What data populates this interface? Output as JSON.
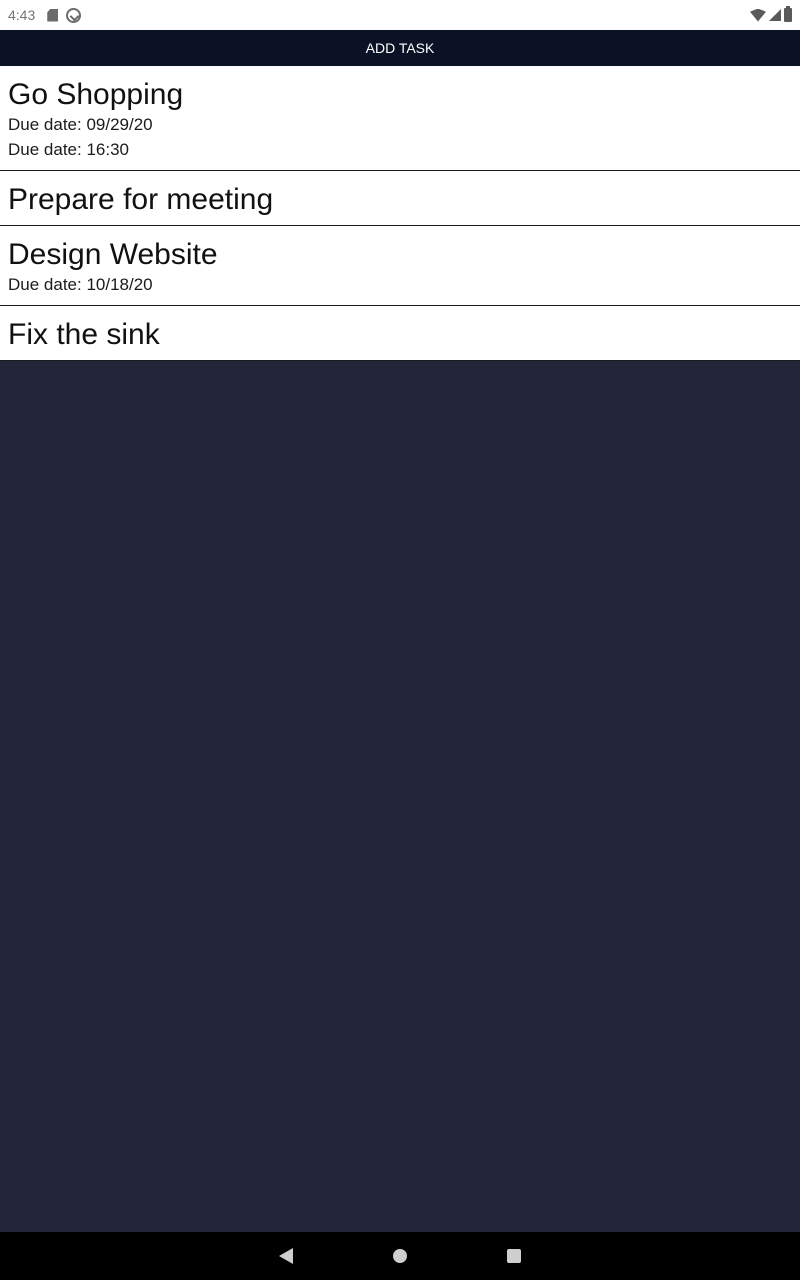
{
  "status_bar": {
    "time": "4:43",
    "left_icons": [
      "sd-card-icon",
      "sync-icon"
    ],
    "right_icons": [
      "wifi-icon",
      "signal-icon",
      "battery-icon"
    ]
  },
  "header": {
    "add_task_label": "ADD TASK"
  },
  "tasks": [
    {
      "title": "Go Shopping",
      "due_lines": [
        "Due date: 09/29/20",
        "Due date: 16:30"
      ]
    },
    {
      "title": "Prepare for meeting",
      "due_lines": []
    },
    {
      "title": "Design Website",
      "due_lines": [
        "Due date: 10/18/20"
      ]
    },
    {
      "title": "Fix the sink",
      "due_lines": []
    }
  ],
  "nav_bar": {
    "icons": [
      "back-icon",
      "home-icon",
      "recents-icon"
    ]
  },
  "colors": {
    "header_bg": "#0b1226",
    "app_bg": "#222538",
    "list_bg": "#ffffff"
  }
}
